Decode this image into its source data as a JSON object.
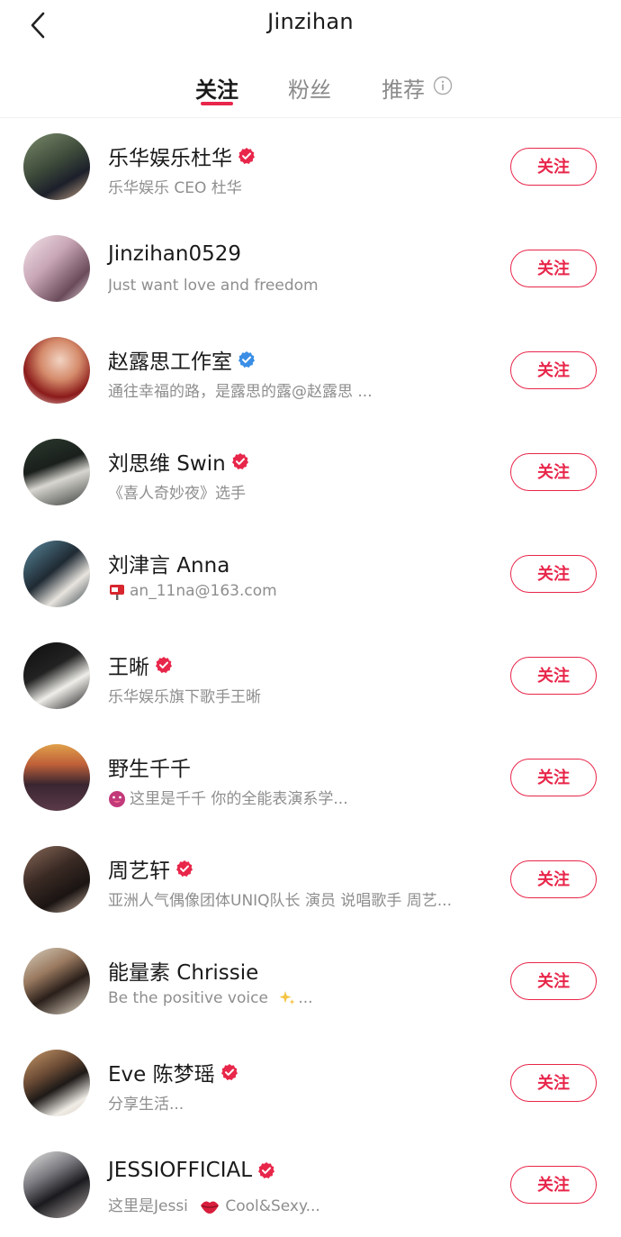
{
  "header": {
    "title": "Jinzihan"
  },
  "tabs": [
    {
      "label": "关注"
    },
    {
      "label": "粉丝"
    },
    {
      "label": "推荐"
    }
  ],
  "colors": {
    "accent": "#e8264a",
    "verified_blue": "#3a8ee6"
  },
  "follow_label": "关注",
  "users": [
    {
      "name": "乐华娱乐杜华",
      "badge": "red",
      "bio": "乐华娱乐 CEO 杜华"
    },
    {
      "name": "Jinzihan0529",
      "badge": "none",
      "bio": "Just want love and freedom"
    },
    {
      "name": "赵露思工作室",
      "badge": "blue",
      "bio": "通往幸福的路，是露思的露@赵露思 ..."
    },
    {
      "name": "刘思维 Swin",
      "badge": "red",
      "bio": "《喜人奇妙夜》选手"
    },
    {
      "name": "刘津言 Anna",
      "badge": "none",
      "bio_icon": "mailbox-icon",
      "bio": "an_11na@163.com"
    },
    {
      "name": "王晰",
      "badge": "red",
      "bio": "乐华娱乐旗下歌手王晰"
    },
    {
      "name": "野生千千",
      "badge": "none",
      "bio_icon": "tongue-icon",
      "bio": "这里是千千 你的全能表演系学..."
    },
    {
      "name": "周艺轩",
      "badge": "red",
      "bio": "亚洲人气偶像团体UNIQ队长 演员 说唱歌手 周艺..."
    },
    {
      "name": "能量素 Chrissie",
      "badge": "none",
      "bio": "Be the positive voice",
      "bio_tail_icon": "sparkles-icon",
      "bio_tail": "..."
    },
    {
      "name": "Eve 陈梦瑶",
      "badge": "red",
      "bio": "分享生活..."
    },
    {
      "name": "JESSIOFFICIAL",
      "badge": "red",
      "bio": "这里是Jessi",
      "bio_tail_icon": "lips-icon",
      "bio_tail": "Cool&Sexy..."
    }
  ]
}
